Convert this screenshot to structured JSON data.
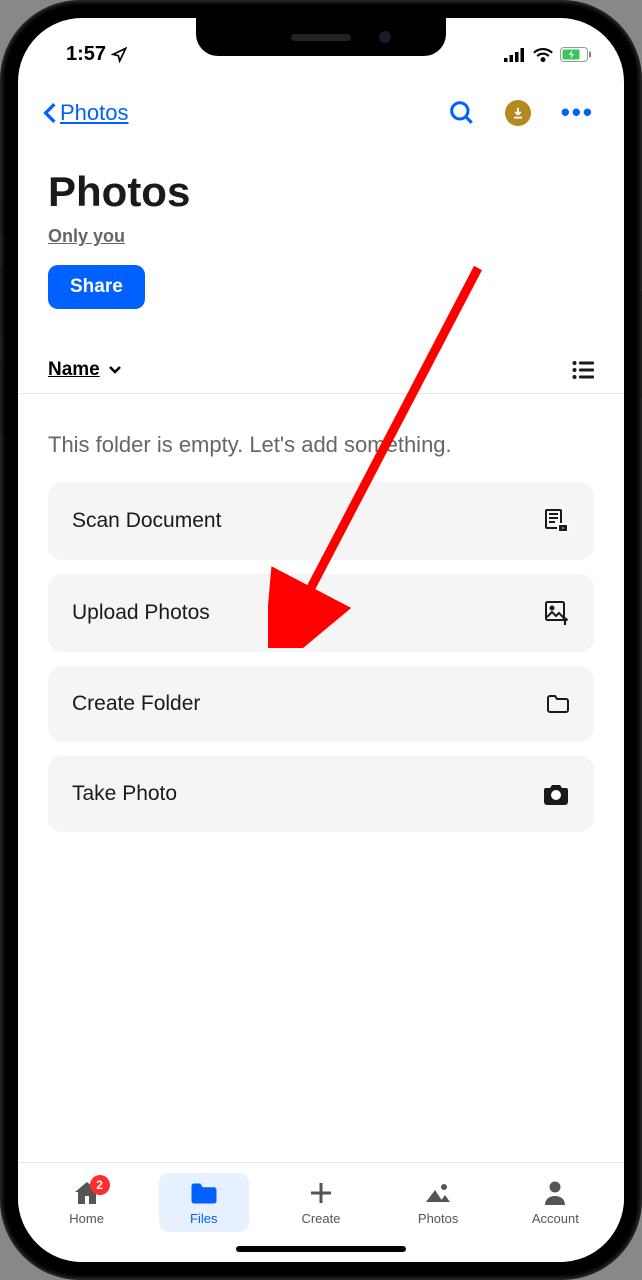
{
  "status": {
    "time": "1:57"
  },
  "nav": {
    "back_label": "Photos"
  },
  "header": {
    "title": "Photos",
    "access": "Only you",
    "share_label": "Share"
  },
  "sort": {
    "label": "Name"
  },
  "empty_message": "This folder is empty. Let's add something.",
  "actions": [
    {
      "label": "Scan Document",
      "icon": "scan-document-icon"
    },
    {
      "label": "Upload Photos",
      "icon": "upload-photos-icon"
    },
    {
      "label": "Create Folder",
      "icon": "folder-icon"
    },
    {
      "label": "Take Photo",
      "icon": "camera-icon"
    }
  ],
  "tabs": [
    {
      "label": "Home",
      "icon": "home-icon",
      "badge": "2"
    },
    {
      "label": "Files",
      "icon": "files-icon",
      "active": true
    },
    {
      "label": "Create",
      "icon": "plus-icon"
    },
    {
      "label": "Photos",
      "icon": "photos-icon"
    },
    {
      "label": "Account",
      "icon": "account-icon"
    }
  ]
}
